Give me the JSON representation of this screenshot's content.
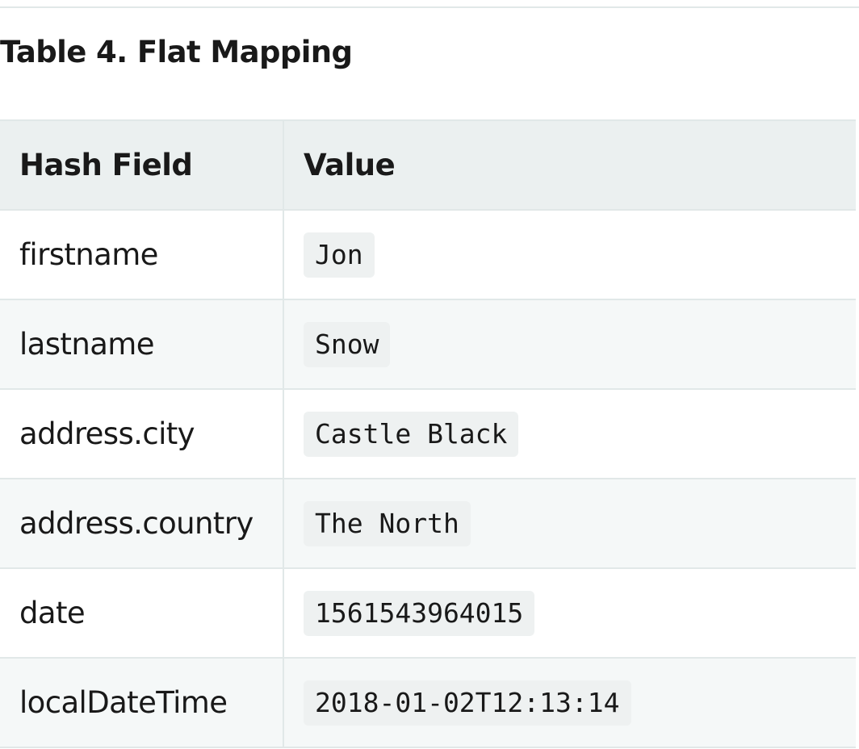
{
  "caption": "Table 4. Flat Mapping",
  "table": {
    "headers": [
      "Hash Field",
      "Value"
    ],
    "rows": [
      {
        "field": "firstname",
        "value": "Jon"
      },
      {
        "field": "lastname",
        "value": "Snow"
      },
      {
        "field": "address.city",
        "value": "Castle Black"
      },
      {
        "field": "address.country",
        "value": "The North"
      },
      {
        "field": "date",
        "value": "1561543964015"
      },
      {
        "field": "localDateTime",
        "value": "2018-01-02T12:13:14"
      }
    ]
  },
  "colors": {
    "header_bg": "#ebf0f0",
    "stripe_bg": "#f5f8f8",
    "border": "#e1e8e8",
    "code_bg": "#eef1f1",
    "text": "#191919"
  }
}
